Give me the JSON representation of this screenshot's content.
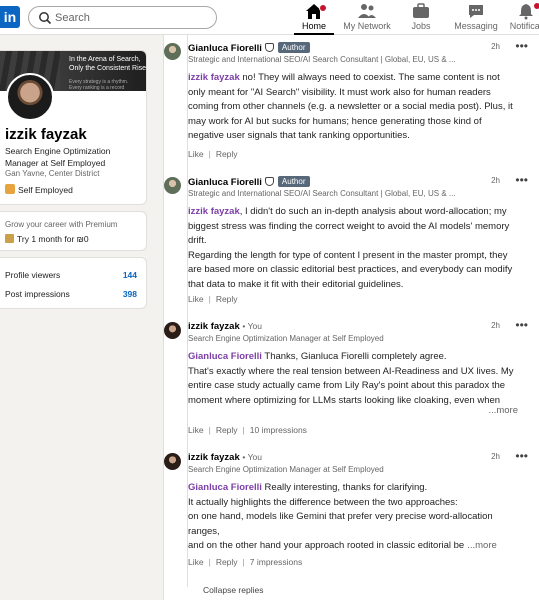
{
  "nav": {
    "logo": "in",
    "search_placeholder": "Search",
    "items": [
      {
        "label": "Home"
      },
      {
        "label": "My Network"
      },
      {
        "label": "Jobs"
      },
      {
        "label": "Messaging"
      },
      {
        "label": "Notificat"
      }
    ]
  },
  "profile": {
    "banner_line1": "In the Arena of Search,",
    "banner_line2": "Only the Consistent Rise",
    "banner_small1": "Every strategy is a rhythm.",
    "banner_small2": "Every ranking is a record",
    "name": "izzik fayzak",
    "headline": "Search Engine Optimization Manager at Self Employed",
    "location": "Gan Yavne, Center District",
    "company": "Self Employed"
  },
  "premium": {
    "title": "Grow your career with Premium",
    "offer": "Try 1 month for ₪0"
  },
  "stats": [
    {
      "label": "Profile viewers",
      "value": "144"
    },
    {
      "label": "Post impressions",
      "value": "398"
    }
  ],
  "comments": [
    {
      "author": "Gianluca Fiorelli",
      "badge": "Author",
      "subtitle": "Strategic and International SEO/AI Search Consultant | Global, EU, US & ...",
      "time": "2h",
      "more": "•••",
      "mention": "izzik fayzak",
      "text": " no! They will always need to coexist. The same content is not only meant for \"AI Search\" visibility. It must work also for human readers coming from other channels (e.g. a newsletter or a social media post). Plus, it may work for AI but sucks for humans; hence generating those kind of negative user signals that tank ranking opportunities.",
      "like": "Like",
      "reply": "Reply"
    },
    {
      "author": "Gianluca Fiorelli",
      "badge": "Author",
      "subtitle": "Strategic and International SEO/AI Search Consultant | Global, EU, US & ...",
      "time": "2h",
      "more": "•••",
      "mention": "izzik fayzak",
      "text": ", I didn't do such an in-depth analysis about word-allocation; my biggest stress was finding the correct weight to avoid the AI models' memory drift.",
      "text2": "Regarding the length for type of content I present in the master prompt, they are based more on classic editorial best practices, and everybody can modify that data to make it fit with their editorial guidelines.",
      "like": "Like",
      "reply": "Reply"
    },
    {
      "author": "izzik fayzak",
      "you": "• You",
      "subtitle": "Search Engine Optimization Manager at Self Employed",
      "time": "2h",
      "more": "•••",
      "mention": "Gianluca Fiorelli",
      "text": " Thanks, Gianluca Fiorelli completely agree.",
      "text2": "That's exactly where the real tension between AI-Readiness and UX lives. My entire case study actually came from Lily Ray's point about this paradox the moment where optimizing for LLMs starts looking like cloaking, even when that's not the intention.",
      "readmore": "...more",
      "like": "Like",
      "reply": "Reply",
      "impressions": "10 impressions"
    },
    {
      "author": "izzik fayzak",
      "you": "• You",
      "subtitle": "Search Engine Optimization Manager at Self Employed",
      "time": "2h",
      "more": "•••",
      "mention": "Gianluca Fiorelli",
      "text": " Really interesting, thanks for clarifying.",
      "text2": "It actually highlights the difference between the two approaches:",
      "text3": "on one hand, models like Gemini that prefer very precise word-allocation ranges,",
      "text4": "and on the other hand your approach rooted in classic editorial be",
      "readmore": "...more",
      "like": "Like",
      "reply": "Reply",
      "impressions": "7 impressions"
    }
  ],
  "collapse_label": "Collapse replies",
  "colors": {
    "brand": "#0a66c2",
    "mention": "#7b3fa6",
    "notification": "#cb112d"
  }
}
